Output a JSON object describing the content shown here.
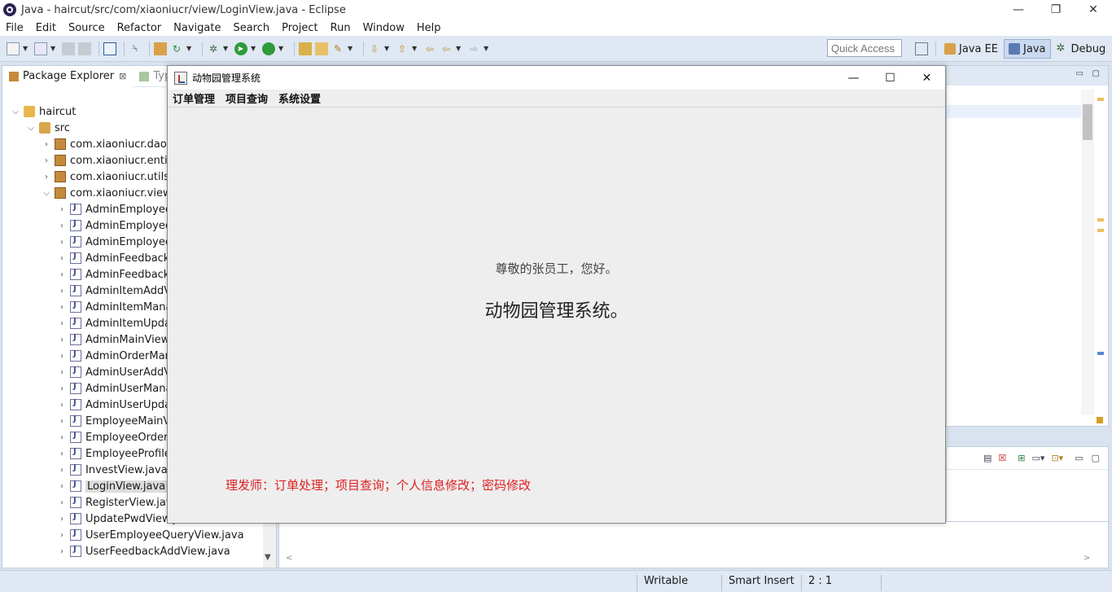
{
  "eclipse": {
    "window_title": "Java - haircut/src/com/xiaoniucr/view/LoginView.java - Eclipse",
    "window_controls": {
      "minimize": "—",
      "restore": "❐",
      "close": "✕"
    },
    "menu": [
      "File",
      "Edit",
      "Source",
      "Refactor",
      "Navigate",
      "Search",
      "Project",
      "Run",
      "Window",
      "Help"
    ],
    "quick_access_placeholder": "Quick Access",
    "perspectives": [
      {
        "label": "Java EE",
        "active": false
      },
      {
        "label": "Java",
        "active": true
      },
      {
        "label": "Debug",
        "active": false
      }
    ],
    "package_explorer": {
      "tab_label": "Package Explorer",
      "tab_close": "⊠",
      "other_tab_label": "Type",
      "tree": [
        {
          "label": "haircut",
          "depth": 0,
          "expanded": true,
          "icon": "project-icon"
        },
        {
          "label": "src",
          "depth": 1,
          "expanded": true,
          "icon": "source-folder-icon"
        },
        {
          "label": "com.xiaoniucr.dao",
          "depth": 2,
          "expanded": false,
          "icon": "package-icon"
        },
        {
          "label": "com.xiaoniucr.entity",
          "depth": 2,
          "expanded": false,
          "icon": "package-icon"
        },
        {
          "label": "com.xiaoniucr.utils",
          "depth": 2,
          "expanded": false,
          "icon": "package-icon"
        },
        {
          "label": "com.xiaoniucr.view",
          "depth": 2,
          "expanded": true,
          "icon": "package-icon"
        },
        {
          "label": "AdminEmployeeA",
          "depth": 3,
          "expanded": false,
          "icon": "java-file-icon"
        },
        {
          "label": "AdminEmployeeN",
          "depth": 3,
          "expanded": false,
          "icon": "java-file-icon"
        },
        {
          "label": "AdminEmployeeU",
          "depth": 3,
          "expanded": false,
          "icon": "java-file-icon"
        },
        {
          "label": "AdminFeedbackM",
          "depth": 3,
          "expanded": false,
          "icon": "java-file-icon"
        },
        {
          "label": "AdminFeedbackR",
          "depth": 3,
          "expanded": false,
          "icon": "java-file-icon"
        },
        {
          "label": "AdminItemAddVi",
          "depth": 3,
          "expanded": false,
          "icon": "java-file-icon"
        },
        {
          "label": "AdminItemManag",
          "depth": 3,
          "expanded": false,
          "icon": "java-file-icon"
        },
        {
          "label": "AdminItemUpdat",
          "depth": 3,
          "expanded": false,
          "icon": "java-file-icon"
        },
        {
          "label": "AdminMainView.j",
          "depth": 3,
          "expanded": false,
          "icon": "java-file-icon"
        },
        {
          "label": "AdminOrderMana",
          "depth": 3,
          "expanded": false,
          "icon": "java-file-icon"
        },
        {
          "label": "AdminUserAddVi",
          "depth": 3,
          "expanded": false,
          "icon": "java-file-icon"
        },
        {
          "label": "AdminUserManag",
          "depth": 3,
          "expanded": false,
          "icon": "java-file-icon"
        },
        {
          "label": "AdminUserUpdat",
          "depth": 3,
          "expanded": false,
          "icon": "java-file-icon"
        },
        {
          "label": "EmployeeMainVie",
          "depth": 3,
          "expanded": false,
          "icon": "java-file-icon"
        },
        {
          "label": "EmployeeOrderM",
          "depth": 3,
          "expanded": false,
          "icon": "java-file-icon"
        },
        {
          "label": "EmployeeProfileV",
          "depth": 3,
          "expanded": false,
          "icon": "java-file-icon"
        },
        {
          "label": "InvestView.java",
          "depth": 3,
          "expanded": false,
          "icon": "java-file-icon"
        },
        {
          "label": "LoginView.java",
          "depth": 3,
          "expanded": false,
          "icon": "java-file-icon",
          "selected": true
        },
        {
          "label": "RegisterView.java",
          "depth": 3,
          "expanded": false,
          "icon": "java-file-icon"
        },
        {
          "label": "UpdatePwdView.java",
          "depth": 3,
          "expanded": false,
          "icon": "java-file-icon"
        },
        {
          "label": "UserEmployeeQueryView.java",
          "depth": 3,
          "expanded": false,
          "icon": "java-file-icon"
        },
        {
          "label": "UserFeedbackAddView.java",
          "depth": 3,
          "expanded": false,
          "icon": "java-file-icon"
        }
      ]
    },
    "status_bar": {
      "writable": "Writable",
      "insert_mode": "Smart Insert",
      "position": "2 : 1"
    }
  },
  "app": {
    "window_title": "动物园管理系统",
    "window_controls": {
      "minimize": "—",
      "maximize": "☐",
      "close": "✕"
    },
    "menu": [
      "订单管理",
      "项目查询",
      "系统设置"
    ],
    "greeting": "尊敬的张员工，您好。",
    "system_title": "动物园管理系统。",
    "role_note": "理发师：订单处理；项目查询；个人信息修改；密码修改"
  }
}
